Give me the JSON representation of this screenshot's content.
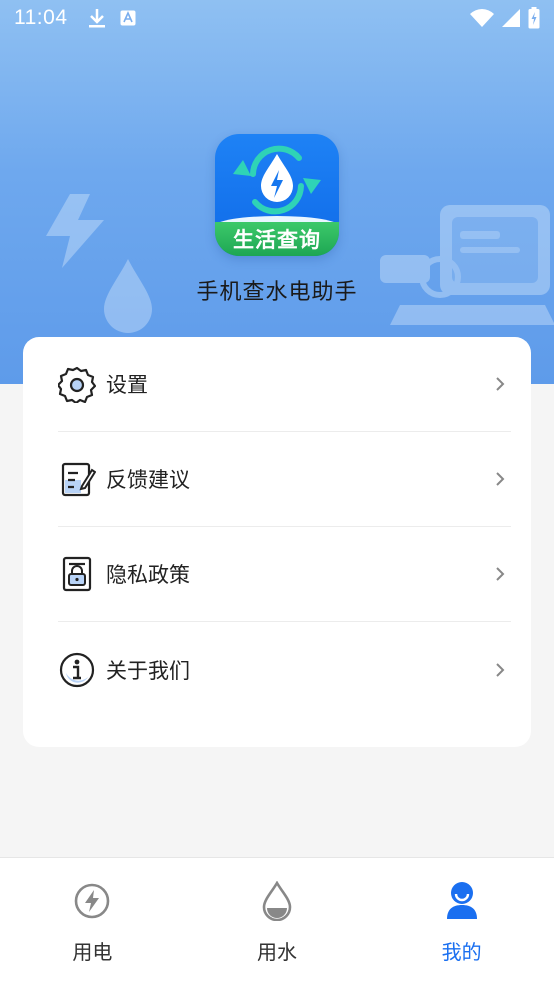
{
  "status_bar": {
    "time": "11:04",
    "icons": [
      "download-icon",
      "font-icon",
      "wifi-icon",
      "signal-icon",
      "battery-charging-icon"
    ]
  },
  "app": {
    "logo_text": "生活查询",
    "name": "手机查水电助手"
  },
  "menu": {
    "items": [
      {
        "label": "设置",
        "icon": "settings-icon"
      },
      {
        "label": "反馈建议",
        "icon": "feedback-icon"
      },
      {
        "label": "隐私政策",
        "icon": "privacy-icon"
      },
      {
        "label": "关于我们",
        "icon": "info-icon"
      }
    ]
  },
  "bottom_nav": {
    "tabs": [
      {
        "label": "用电",
        "icon": "electricity-icon",
        "active": false
      },
      {
        "label": "用水",
        "icon": "water-drop-icon",
        "active": false
      },
      {
        "label": "我的",
        "icon": "user-icon",
        "active": true
      }
    ]
  },
  "colors": {
    "accent": "#1a6ff0",
    "hero_top": "#8fc0f2",
    "hero_bottom": "#5e9bea",
    "logo_green": "#1ea653"
  }
}
